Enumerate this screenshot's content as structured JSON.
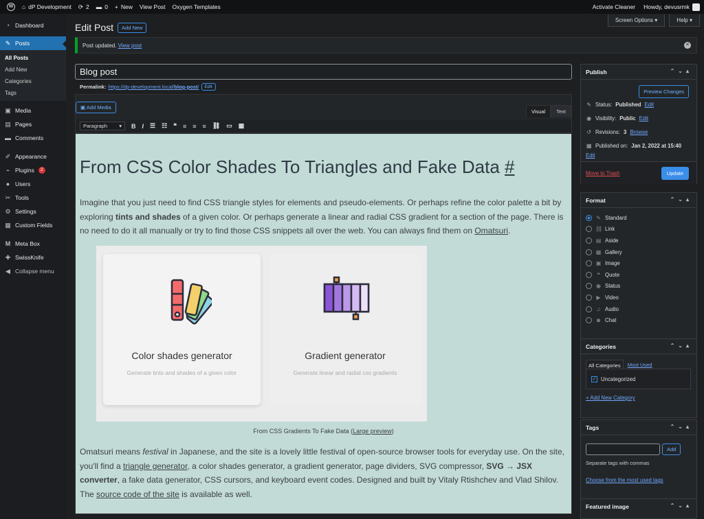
{
  "adminbar": {
    "site": "dP Development",
    "updates": "2",
    "comments": "0",
    "new": "New",
    "view_post": "View Post",
    "oxygen": "Oxygen Templates",
    "activate": "Activate Cleaner",
    "howdy": "Howdy, devusrmk"
  },
  "sidebar": {
    "items": [
      {
        "label": "Dashboard",
        "icon": "dashboard-icon",
        "glyph": "◔"
      },
      {
        "label": "Posts",
        "icon": "pin-icon",
        "glyph": "✎"
      },
      {
        "label": "Media",
        "icon": "media-icon",
        "glyph": "▣"
      },
      {
        "label": "Pages",
        "icon": "pages-icon",
        "glyph": "▤"
      },
      {
        "label": "Comments",
        "icon": "comments-icon",
        "glyph": "▬"
      },
      {
        "label": "Appearance",
        "icon": "brush-icon",
        "glyph": "✐"
      },
      {
        "label": "Plugins",
        "icon": "plug-icon",
        "glyph": "⌁"
      },
      {
        "label": "Users",
        "icon": "users-icon",
        "glyph": "●"
      },
      {
        "label": "Tools",
        "icon": "wrench-icon",
        "glyph": "✂"
      },
      {
        "label": "Settings",
        "icon": "settings-icon",
        "glyph": "⚙"
      },
      {
        "label": "Custom Fields",
        "icon": "fields-icon",
        "glyph": "▦"
      },
      {
        "label": "Meta Box",
        "icon": "metabox-icon",
        "glyph": "M"
      },
      {
        "label": "SwissKnife",
        "icon": "swissknife-icon",
        "glyph": "✚"
      },
      {
        "label": "Collapse menu",
        "icon": "collapse-icon",
        "glyph": "◀"
      }
    ],
    "posts_sub": [
      "All Posts",
      "Add New",
      "Categories",
      "Tags"
    ],
    "plugins_badge": "2"
  },
  "header": {
    "title": "Edit Post",
    "add_new": "Add New",
    "screen_options": "Screen Options ▾",
    "help": "Help ▾"
  },
  "notice": {
    "text": "Post updated.",
    "link": "View post"
  },
  "post": {
    "title": "Blog post",
    "permalink_label": "Permalink:",
    "permalink_base": "https://dp-development.local/",
    "permalink_slug": "blog-post",
    "permalink_end": "/",
    "edit": "Edit"
  },
  "editor": {
    "add_media": "Add Media",
    "tab_visual": "Visual",
    "tab_text": "Text",
    "format": "Paragraph"
  },
  "content": {
    "heading": "From CSS Color Shades To Triangles and Fake Data",
    "heading_anchor": "#",
    "p1_a": "Imagine that you just need to find CSS triangle styles for elements and pseudo-elements. Or perhaps refine the color palette a bit by exploring ",
    "p1_b": "tints and shades",
    "p1_c": " of a given color. Or perhaps generate a linear and radial CSS gradient for a section of the page. There is no need to do it all manually or try to find those CSS snippets all over the web. You can always find them on ",
    "p1_link": "Omatsuri",
    "p1_end": ".",
    "card1_title": "Color shades generator",
    "card1_sub": "Generate tints and shades of a given color",
    "card2_title": "Gradient generator",
    "card2_sub": "Generate linear and radial css gradients",
    "caption_a": "From CSS Gradients To Fake Data (",
    "caption_link": "Large preview",
    "caption_b": ")",
    "p2_a": "Omatsuri means ",
    "p2_em": "festival",
    "p2_b": " in Japanese, and the site is a lovely little festival of open-source browser tools for everyday use. On the site, you'll find a ",
    "p2_link1": "triangle generator",
    "p2_c": ", a color shades generator, a gradient generator, page dividers, SVG compressor, ",
    "p2_strong": "SVG → JSX converter",
    "p2_d": ", a fake data generator, CSS cursors, and keyboard event codes. Designed and built by Vitaly Rtishchev and Vlad Shilov. The ",
    "p2_link2": "source code of the site",
    "p2_e": " is available as well."
  },
  "publish": {
    "title": "Publish",
    "preview": "Preview Changes",
    "status_label": "Status:",
    "status": "Published",
    "visibility_label": "Visibility:",
    "visibility": "Public",
    "revisions_label": "Revisions:",
    "revisions": "3",
    "browse": "Browse",
    "published_label": "Published on:",
    "published": "Jan 2, 2022 at 15:40",
    "edit": "Edit",
    "trash": "Move to Trash",
    "update": "Update"
  },
  "format": {
    "title": "Format",
    "options": [
      {
        "label": "Standard",
        "glyph": "✎",
        "on": true
      },
      {
        "label": "Link",
        "glyph": "⛓",
        "on": false
      },
      {
        "label": "Aside",
        "glyph": "▤",
        "on": false
      },
      {
        "label": "Gallery",
        "glyph": "▦",
        "on": false
      },
      {
        "label": "Image",
        "glyph": "▣",
        "on": false
      },
      {
        "label": "Quote",
        "glyph": "❝",
        "on": false
      },
      {
        "label": "Status",
        "glyph": "◉",
        "on": false
      },
      {
        "label": "Video",
        "glyph": "▶",
        "on": false
      },
      {
        "label": "Audio",
        "glyph": "♫",
        "on": false
      },
      {
        "label": "Chat",
        "glyph": "◙",
        "on": false
      }
    ]
  },
  "categories": {
    "title": "Categories",
    "tab_all": "All Categories",
    "tab_most": "Most Used",
    "item": "Uncategorized",
    "add": "+ Add New Category"
  },
  "tags": {
    "title": "Tags",
    "add": "Add",
    "hint": "Separate tags with commas",
    "choose": "Choose from the most used tags"
  },
  "featured": {
    "title": "Featured image"
  }
}
